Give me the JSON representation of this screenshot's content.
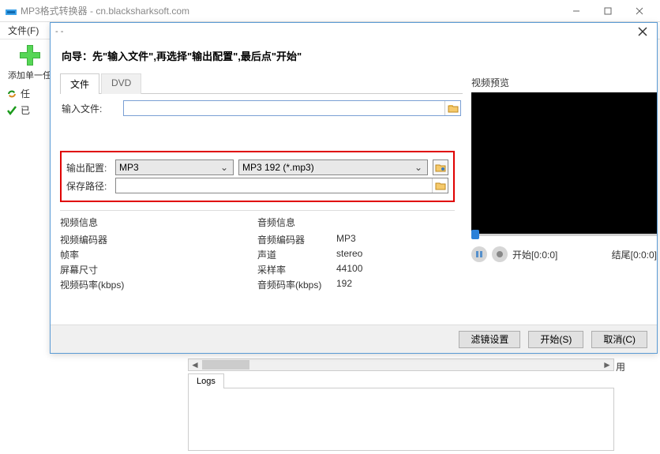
{
  "main_window": {
    "title": "MP3格式转换器 - cn.blacksharksoft.com",
    "menu": {
      "file": "文件(F)"
    },
    "toolbar": {
      "add_single_task": "添加单一任"
    },
    "tree": {
      "task": "任",
      "done": "已"
    }
  },
  "dialog": {
    "title_prefix": "- -",
    "wizard_title": "向导：先\"输入文件\",再选择\"输出配置\",最后点\"开始\"",
    "tabs": {
      "file": "文件",
      "dvd": "DVD"
    },
    "input_file_label": "输入文件:",
    "input_file_value": "",
    "video_preview_label": "视频预览",
    "output": {
      "config_label": "输出配置:",
      "format_selected": "MP3",
      "profile_selected": "MP3 192 (*.mp3)",
      "save_path_label": "保存路径:",
      "save_path_value": ""
    },
    "video_info": {
      "title": "视频信息",
      "encoder_label": "视频编码器",
      "fps_label": "帧率",
      "size_label": "屏幕尺寸",
      "bitrate_label": "视频码率(kbps)"
    },
    "audio_info": {
      "title": "音频信息",
      "encoder_label": "音频编码器",
      "encoder_value": "MP3",
      "channel_label": "声道",
      "channel_value": "stereo",
      "samplerate_label": "采样率",
      "samplerate_value": "44100",
      "bitrate_label": "音频码率(kbps)",
      "bitrate_value": "192"
    },
    "player": {
      "start_label": "开始",
      "start_time": "[0:0:0]",
      "end_label": "结尾",
      "end_time": "[0:0:0]"
    },
    "footer": {
      "filter": "滤镜设置",
      "start": "开始(S)",
      "cancel": "取消(C)"
    }
  },
  "bg": {
    "yong": "用",
    "logs_tab": "Logs"
  }
}
